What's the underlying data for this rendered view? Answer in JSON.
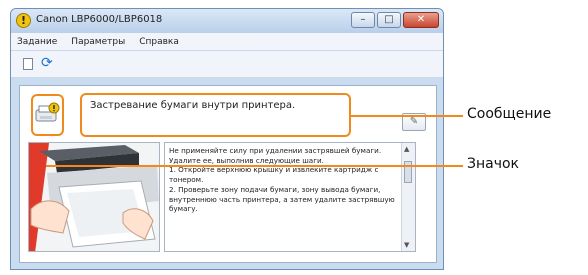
{
  "window": {
    "title": "Canon LBP6000/LBP6018",
    "buttons": [
      "–",
      "□",
      "✕"
    ]
  },
  "menu": [
    {
      "label": "Задание"
    },
    {
      "label": "Параметры"
    },
    {
      "label": "Справка"
    }
  ],
  "message": "Застревание бумаги внутри принтера.",
  "instructions": "Не применяйте силу при удалении застрявшей бумаги. Удалите ее, выполнив следующие шаги.\n1. Откройте верхнюю крышку и извлеките картридж с тонером.\n2. Проверьте зону подачи бумаги, зону вывода бумаги, внутреннюю часть принтера, а затем удалите застрявшую бумагу.",
  "annotations": {
    "message_label": "Сообщение",
    "icon_label": "Значок"
  },
  "colors": {
    "highlight": "#f08a1c",
    "window_frame": "#c9dcf0"
  },
  "icons": {
    "status": "warning-icon",
    "refresh": "refresh-icon",
    "page": "page-icon",
    "note": "note-icon"
  }
}
